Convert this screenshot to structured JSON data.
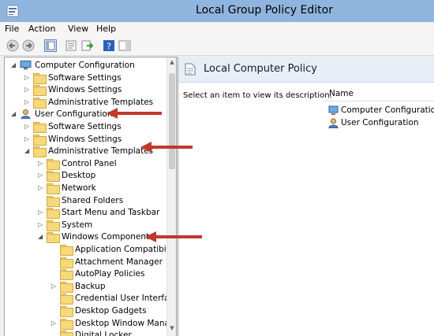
{
  "window": {
    "title": "Local Group Policy Editor"
  },
  "menu": [
    "File",
    "Action",
    "View",
    "Help"
  ],
  "toolbar": {
    "buttons": [
      "back-icon",
      "forward-icon",
      "show-hide-tree-icon",
      "properties-icon",
      "export-list-icon",
      "help-icon",
      "action-pane-icon"
    ]
  },
  "tree": [
    {
      "label": "Computer Configuration",
      "level": 0,
      "expander": "expanded",
      "icon": "computer-icon"
    },
    {
      "label": "Software Settings",
      "level": 1,
      "expander": "collapsed",
      "icon": "folder-icon"
    },
    {
      "label": "Windows Settings",
      "level": 1,
      "expander": "collapsed",
      "icon": "folder-icon"
    },
    {
      "label": "Administrative Templates",
      "level": 1,
      "expander": "collapsed",
      "icon": "folder-icon"
    },
    {
      "label": "User Configuration",
      "level": 0,
      "expander": "expanded",
      "icon": "user-icon"
    },
    {
      "label": "Software Settings",
      "level": 1,
      "expander": "collapsed",
      "icon": "folder-icon"
    },
    {
      "label": "Windows Settings",
      "level": 1,
      "expander": "collapsed",
      "icon": "folder-icon"
    },
    {
      "label": "Administrative Templates",
      "level": 1,
      "expander": "expanded",
      "icon": "folder-icon"
    },
    {
      "label": "Control Panel",
      "level": 2,
      "expander": "collapsed",
      "icon": "folder-icon"
    },
    {
      "label": "Desktop",
      "level": 2,
      "expander": "collapsed",
      "icon": "folder-icon"
    },
    {
      "label": "Network",
      "level": 2,
      "expander": "collapsed",
      "icon": "folder-icon"
    },
    {
      "label": "Shared Folders",
      "level": 2,
      "expander": "none",
      "icon": "folder-icon"
    },
    {
      "label": "Start Menu and Taskbar",
      "level": 2,
      "expander": "collapsed",
      "icon": "folder-icon"
    },
    {
      "label": "System",
      "level": 2,
      "expander": "collapsed",
      "icon": "folder-icon"
    },
    {
      "label": "Windows Components",
      "level": 2,
      "expander": "expanded",
      "icon": "folder-icon"
    },
    {
      "label": "Application Compatibili",
      "level": 3,
      "expander": "none",
      "icon": "folder-icon"
    },
    {
      "label": "Attachment Manager",
      "level": 3,
      "expander": "none",
      "icon": "folder-icon"
    },
    {
      "label": "AutoPlay Policies",
      "level": 3,
      "expander": "none",
      "icon": "folder-icon"
    },
    {
      "label": "Backup",
      "level": 3,
      "expander": "collapsed",
      "icon": "folder-icon"
    },
    {
      "label": "Credential User Interface",
      "level": 3,
      "expander": "none",
      "icon": "folder-icon"
    },
    {
      "label": "Desktop Gadgets",
      "level": 3,
      "expander": "none",
      "icon": "folder-icon"
    },
    {
      "label": "Desktop Window Manag",
      "level": 3,
      "expander": "collapsed",
      "icon": "folder-icon"
    },
    {
      "label": "Digital Locker",
      "level": 3,
      "expander": "none",
      "icon": "folder-icon"
    }
  ],
  "right_pane": {
    "title": "Local Computer Policy",
    "description": "Select an item to view its description.",
    "column_header": "Name",
    "items": [
      {
        "label": "Computer Configuration",
        "icon": "computer-icon"
      },
      {
        "label": "User Configuration",
        "icon": "user-icon"
      }
    ]
  },
  "annotations": {
    "arrow_color": "#c0392b",
    "arrows": [
      "arrow-to-user-configuration",
      "arrow-to-administrative-templates",
      "arrow-to-windows-components"
    ]
  },
  "colors": {
    "titlebar": "#8fb5df",
    "folder_fill": "#f5d97a",
    "folder_border": "#d4a93c",
    "header_bg": "#e7eef8"
  }
}
